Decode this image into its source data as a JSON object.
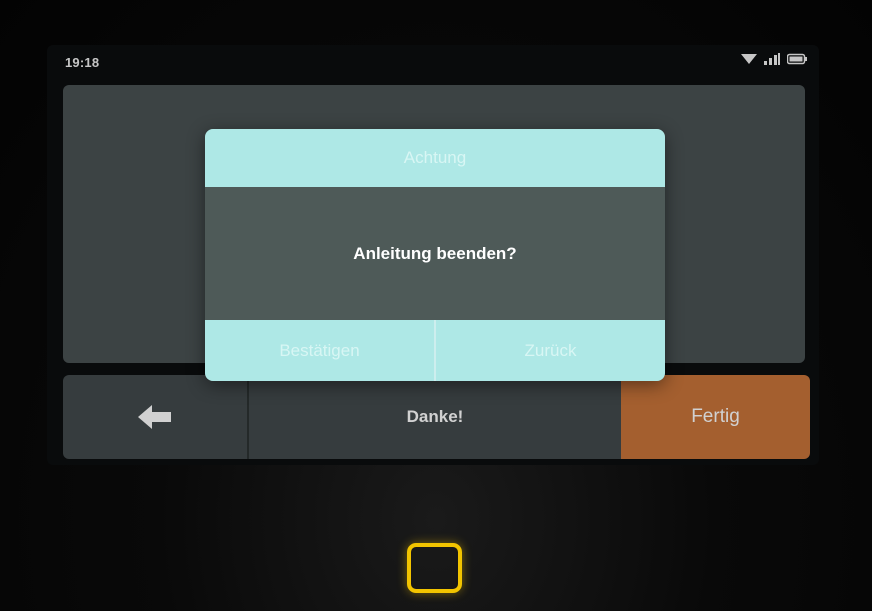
{
  "statusbar": {
    "time": "19:18",
    "icons": [
      "wifi-icon",
      "signal-icon",
      "battery-icon"
    ]
  },
  "dialog": {
    "title": "Achtung",
    "message": "Anleitung beenden?",
    "confirm_label": "Bestätigen",
    "back_label": "Zurück"
  },
  "bottom_bar": {
    "back_icon": "arrow-left-icon",
    "center_label": "Danke!",
    "done_label": "Fertig"
  },
  "colors": {
    "accent_orange": "#c8743a",
    "dialog_header": "#aee8e6",
    "dialog_body": "#4e5a58",
    "panel": "#4a5254",
    "home_key": "#f2c400"
  }
}
